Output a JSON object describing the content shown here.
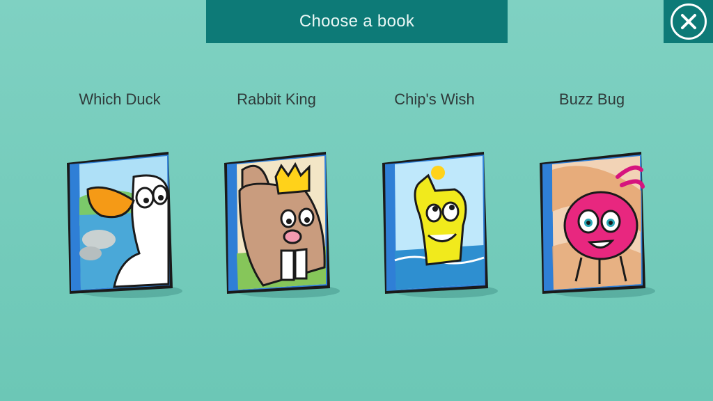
{
  "header": {
    "title": "Choose a book"
  },
  "books": [
    {
      "title": "Which Duck"
    },
    {
      "title": "Rabbit King"
    },
    {
      "title": "Chip's Wish"
    },
    {
      "title": "Buzz Bug"
    }
  ],
  "colors": {
    "background": "#7fd1c2",
    "header": "#0d7a77",
    "spine": "#2f7fd6",
    "title_text": "#2f3a3a"
  }
}
